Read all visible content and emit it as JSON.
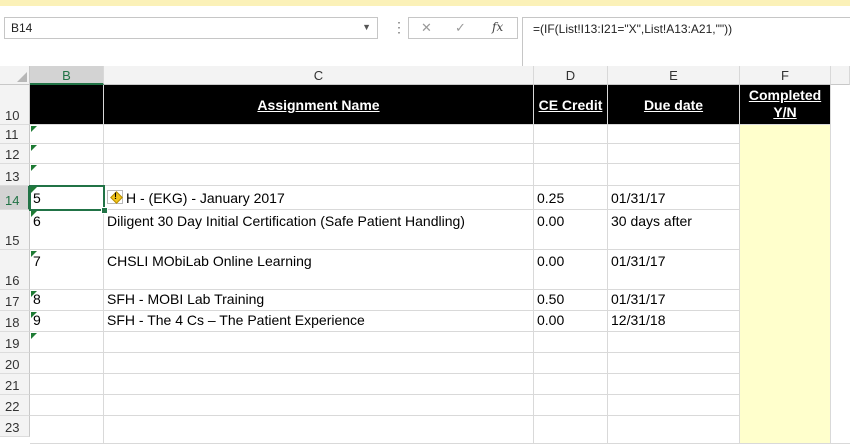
{
  "formula_bar": {
    "name_box": "B14",
    "cancel_glyph": "✕",
    "enter_glyph": "✓",
    "fx_label": "fx",
    "formula": "=(IF(List!I13:I21=\"X\",List!A13:A21,\"\"))"
  },
  "columns": [
    "B",
    "C",
    "D",
    "E",
    "F"
  ],
  "rows": [
    "10",
    "11",
    "12",
    "13",
    "14",
    "15",
    "16",
    "17",
    "18",
    "19",
    "20",
    "21",
    "22",
    "23"
  ],
  "headers": {
    "assignment_name": "Assignment Name",
    "ce_credit": "CE Credit",
    "due_date": "Due date",
    "completed": "Completed Y/N"
  },
  "data_rows": [
    {
      "row": "14",
      "num": "5",
      "name": "H - (EKG) - January 2017",
      "credit": "0.25",
      "due": "01/31/17"
    },
    {
      "row": "15",
      "num": "6",
      "name": "Diligent 30 Day Initial Certification (Safe Patient Handling)",
      "credit": "0.00",
      "due": "30 days after"
    },
    {
      "row": "16",
      "num": "7",
      "name": "CHSLI MObiLab Online Learning",
      "credit": "0.00",
      "due": "01/31/17"
    },
    {
      "row": "17",
      "num": "8",
      "name": "SFH - MOBI Lab Training",
      "credit": "0.50",
      "due": "01/31/17"
    },
    {
      "row": "18",
      "num": "9",
      "name": "SFH - The 4 Cs – The Patient Experience",
      "credit": "0.00",
      "due": "12/31/18"
    }
  ],
  "colors": {
    "accent_green": "#217346",
    "header_black": "#000000",
    "completed_fill": "#ffffcc"
  }
}
